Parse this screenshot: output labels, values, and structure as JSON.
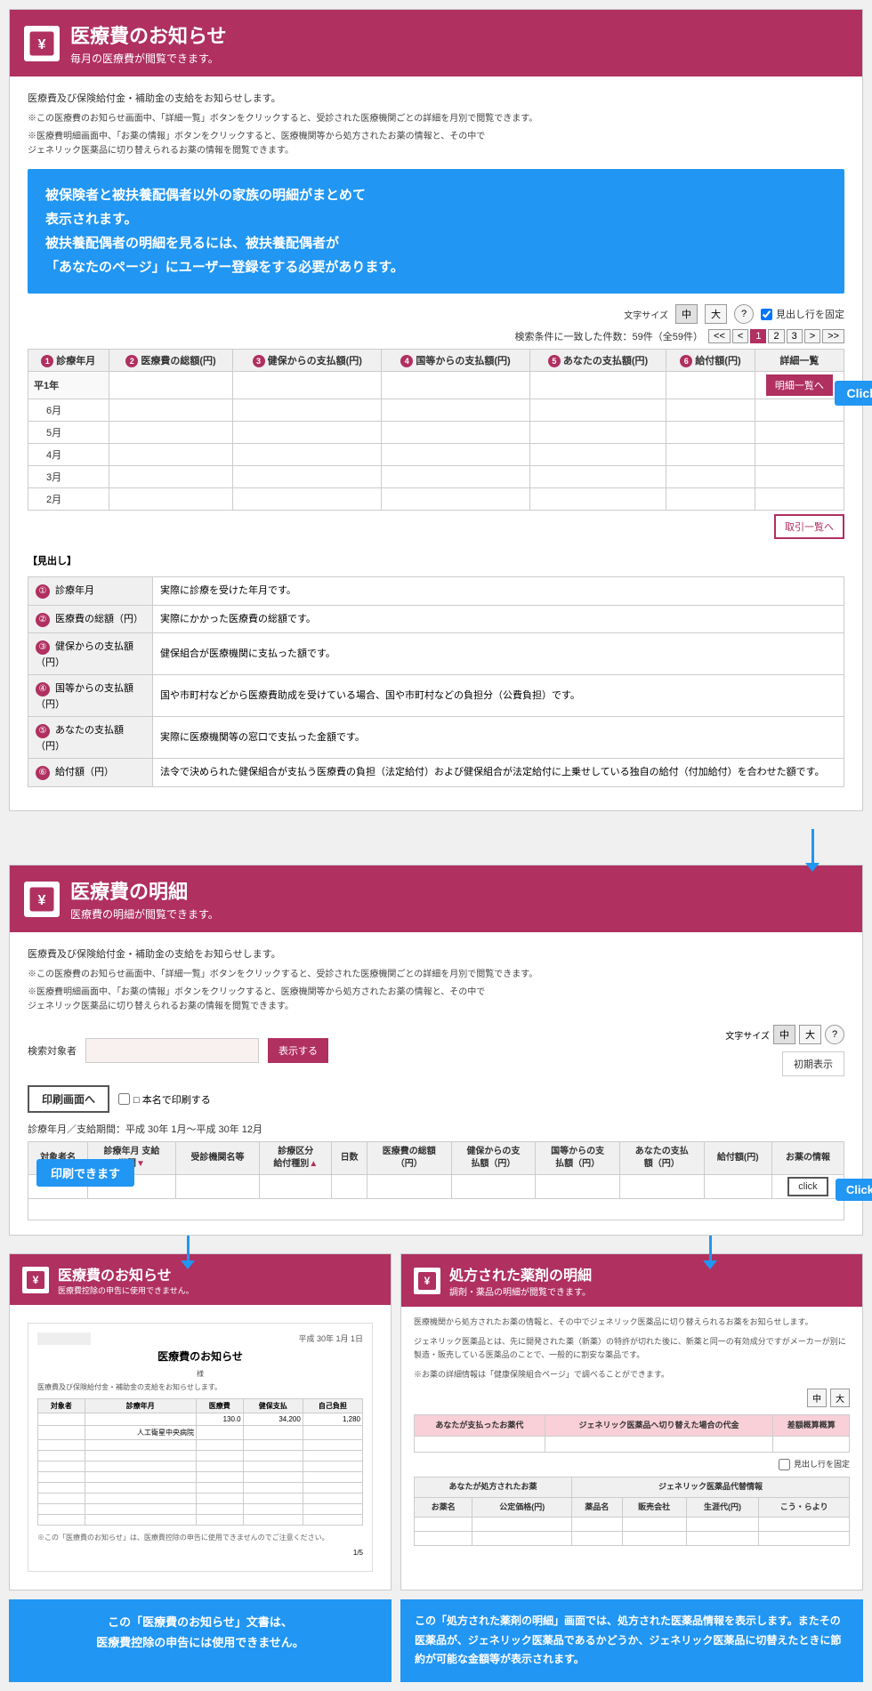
{
  "section1": {
    "header": {
      "icon": "¥",
      "title": "医療費のお知らせ",
      "subtitle": "毎月の医療費が閲覧できます。"
    },
    "notice1": "医療費及び保険給付金・補助金の支給をお知らせします。",
    "notice2": "※この医療費のお知らせ画面中、「詳細一覧」ボタンをクリックすると、受診された医療機関ごとの詳細を月別で閲覧できます。",
    "notice3": "※医療費明細画面中、「お薬の情報」ボタンをクリックすると、医療機関等から処方されたお薬の情報と、その中でジェネリック医薬品に切り替えられるお薬の情報を閲覧できます。",
    "blue_box": "被保険者と被扶養配偶者以外の家族の明細がまとめて\n表示されます。\n被扶養配偶者の明細を見るには、被扶養配偶者が\n「あなたのページ」にユーザー登録をする必要があります。",
    "font_size": {
      "medium": "中",
      "large": "大",
      "help": "?",
      "label": "文字サイズ",
      "fix_row": "見出し行を固定"
    },
    "result_info": "検索条件に一致した件数：59件（全59件）",
    "pagination": [
      "<<",
      "<",
      "1",
      "2",
      "3",
      ">",
      ">>"
    ],
    "table": {
      "headers": [
        "診療年月",
        "医療費の総額(円)",
        "健保からの支払額(円)",
        "国等からの支払額(円)",
        "あなたの支払額(円)",
        "給付額(円)",
        "詳細一覧"
      ],
      "col_nums": [
        "1",
        "2",
        "3",
        "4",
        "5",
        "6"
      ],
      "rows": [
        {
          "year": "平1年",
          "months": [
            "6月",
            "5月",
            "4月",
            "3月",
            "2月"
          ]
        },
        {
          "year": "",
          "months": []
        }
      ],
      "detail_btn": "明細一覧へ",
      "bottom_btn": "取引一覧へ"
    },
    "click_label": "Click",
    "desc_label": "【見出し】",
    "descriptions": [
      {
        "num": "①",
        "label": "診療年月",
        "text": "実際に診療を受けた年月です。"
      },
      {
        "num": "②",
        "label": "医療費の総額（円）",
        "text": "実際にかかった医療費の総額です。"
      },
      {
        "num": "③",
        "label": "健保からの支払額（円）",
        "text": "健保組合が医療機関に支払った額です。"
      },
      {
        "num": "④",
        "label": "国等からの支払額（円）",
        "text": "国や市町村などから医療費助成を受けている場合、国や市町村などの負担分（公費負担）です。"
      },
      {
        "num": "⑤",
        "label": "あなたの支払額（円）",
        "text": "実際に医療機関等の窓口で支払った金額です。"
      },
      {
        "num": "⑥",
        "label": "給付額（円）",
        "text": "法令で決められた健保組合が支払う医療費の負担（法定給付）および健保組合が法定給付に上乗せしている独自の給付（付加給付）を合わせた額です。"
      }
    ]
  },
  "section2": {
    "header": {
      "icon": "¥",
      "title": "医療費の明細",
      "subtitle": "医療費の明細が閲覧できます。"
    },
    "notice1": "医療費及び保険給付金・補助金の支給をお知らせします。",
    "notice2": "※この医療費のお知らせ画面中、「詳細一覧」ボタンをクリックすると、受診された医療機関ごとの詳細を月別で閲覧できます。",
    "notice3": "※医療費明細画面中、「お薬の情報」ボタンをクリックすると、医療機関等から処方されたお薬の情報と、その中でジェネリック医薬品に切り替えられるお薬の情報を閲覧できます。",
    "search": {
      "label": "検索対象者",
      "placeholder": "",
      "display_btn": "表示する",
      "reset_btn": "初期表示",
      "font_size_label": "文字サイズ",
      "medium": "中",
      "large": "大",
      "help": "?"
    },
    "print_btn": "印刷画面へ",
    "print_name_label": "□ 本名で印刷する",
    "period_label": "診療年月／支給期間：平成 30年 1月〜平成 30年 12月",
    "table": {
      "headers": [
        "対象者名",
        "診療年月 支給期間▼",
        "受診機関名等",
        "診療区分 給付種別▲",
        "日数",
        "医療費の総額（円）",
        "健保からの支払額（円）",
        "国等からの支払額（円）",
        "あなたの支払額（円）",
        "給付額(円)",
        "お薬の情報"
      ]
    },
    "print_possible": "印刷できます",
    "click_label": "Click",
    "click_btn": "click"
  },
  "bottom": {
    "left": {
      "header": {
        "title": "医療費のお知らせ",
        "subtitle": "医療費控除の申告に使用できません。"
      },
      "preview_title": "医療費のお知らせ",
      "preview_date": "平成 30年 1月 1日",
      "preview_name": "様",
      "page_num": "1/5",
      "caption": "この「医療費のお知らせ」文書は、\n医療費控除の申告には使用できません。"
    },
    "right": {
      "header": {
        "title": "処方された薬剤の明細",
        "subtitle": "調剤・薬品の明細が閲覧できます。"
      },
      "notice1": "医療機関から処方されたお薬の情報と、その中でジェネリック医薬品に切り替えられるお薬をお知らせします。",
      "notice2": "ジェネリック医薬品とは、先に開発された薬（新薬）の特許が切れた後に、新薬と同一の有効成分ですがメーカーが別に製造・販売している医薬品のことで、一般的に割安な薬品です。",
      "notice3": "※お薬の詳細情報は「健康保険組合ページ」で調べることができます。",
      "drug_table1": {
        "headers": [
          "あなたが支払ったお薬代",
          "ジェネリック医薬品へ切り替えた場合の代金",
          "差額(概算概算)"
        ]
      },
      "drug_table2": {
        "headers": [
          "あなたが処方されたお薬",
          "",
          "",
          "",
          "",
          ""
        ],
        "sub_headers": [
          "お薬名",
          "公定価格(円)",
          "薬品名",
          "販売会社",
          "生涯代(円)",
          "こう・らより"
        ]
      },
      "fix_row": "見出し行を固定",
      "font_size": {
        "medium": "中",
        "large": "大"
      },
      "caption": "この「処方された薬剤の明細」画面では、処方された医薬品情報を表示します。またその医薬品が、ジェネリック医薬品であるかどうか、ジェネリック医薬品に切替えたときに節約が可能な金額等が表示されます。"
    }
  }
}
